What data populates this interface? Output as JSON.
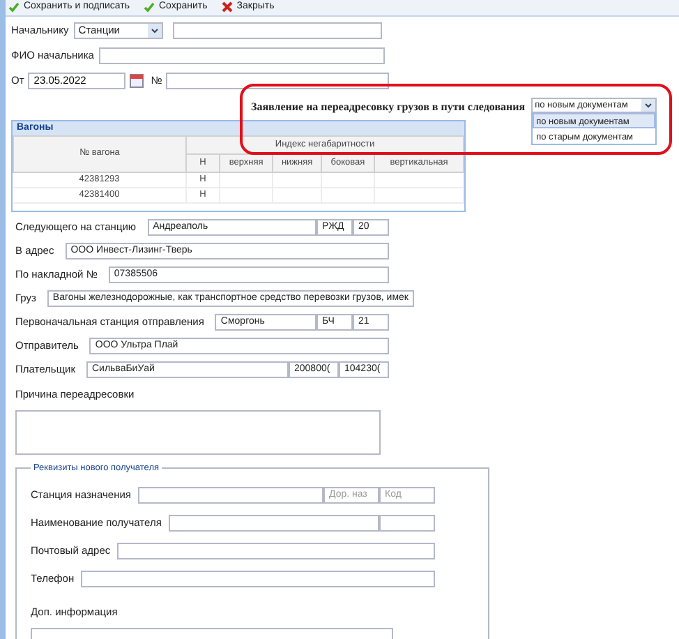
{
  "toolbar": [
    {
      "label": "Сохранить и подписать",
      "kind": "check"
    },
    {
      "label": "Сохранить",
      "kind": "check"
    },
    {
      "label": "Закрыть",
      "kind": "close"
    }
  ],
  "chief": {
    "label": "Начальнику",
    "select_value": "Станции"
  },
  "chief_name": {
    "label": "ФИО начальника"
  },
  "date": {
    "label": "От",
    "value": "23.05.2022",
    "number_label": "№"
  },
  "callout": {
    "title": "Заявление на переадресовку грузов в пути следования",
    "dropdown": {
      "value": "по новым документам",
      "options": [
        {
          "label": "по новым документам",
          "selected": true
        },
        {
          "label": "по старым документам",
          "selected": false
        }
      ]
    }
  },
  "wagons": {
    "title": "Вагоны",
    "number_column": "№ вагона",
    "group_column": "Индекс негабаритности",
    "sub_columns": [
      "Н",
      "верхняя",
      "нижняя",
      "боковая",
      "вертикальная"
    ],
    "rows": [
      {
        "cells": [
          "42381293",
          "Н"
        ]
      },
      {
        "cells": [
          "42381400",
          "Н"
        ]
      }
    ]
  },
  "fields": [
    {
      "label": "Следующего на станцию",
      "inputs": [
        "Андреаполь",
        "РЖД",
        "20"
      ]
    },
    {
      "label": "В адрес",
      "inputs": [
        "ООО Инвест-Лизинг-Тверь"
      ]
    },
    {
      "label": "По накладной №",
      "inputs": [
        "07385506"
      ]
    },
    {
      "label": "Груз",
      "inputs": [
        "Вагоны железнодорожные, как транспортное средство перевозки грузов, имек"
      ]
    },
    {
      "label": "Первоначальная станция отправления",
      "inputs": [
        "Сморгонь",
        "БЧ",
        "21"
      ]
    },
    {
      "label": "Отправитель",
      "inputs": [
        "ООО Ультра Плай"
      ]
    },
    {
      "label": "Плательщик",
      "inputs": [
        "СильваБиУай",
        "200800(",
        "104230("
      ]
    }
  ],
  "reason": {
    "label": "Причина переадресовки"
  },
  "recipient": {
    "legend": "Реквизиты нового получателя",
    "fields": [
      {
        "label": "Станция назначения",
        "inputs": [
          {
            "kind": "wide"
          },
          {
            "kind": "short",
            "placeholder": "Дор. наз"
          },
          {
            "kind": "short",
            "placeholder": "Код"
          }
        ]
      },
      {
        "label": "Наименование получателя",
        "inputs": [
          {
            "kind": "wide"
          },
          {
            "kind": "short"
          }
        ]
      },
      {
        "label": "Почтовый адрес",
        "inputs": [
          {
            "kind": "wide"
          }
        ]
      },
      {
        "label": "Телефон",
        "inputs": [
          {
            "kind": "wide"
          }
        ]
      }
    ],
    "extra_label": "Доп. информация"
  }
}
